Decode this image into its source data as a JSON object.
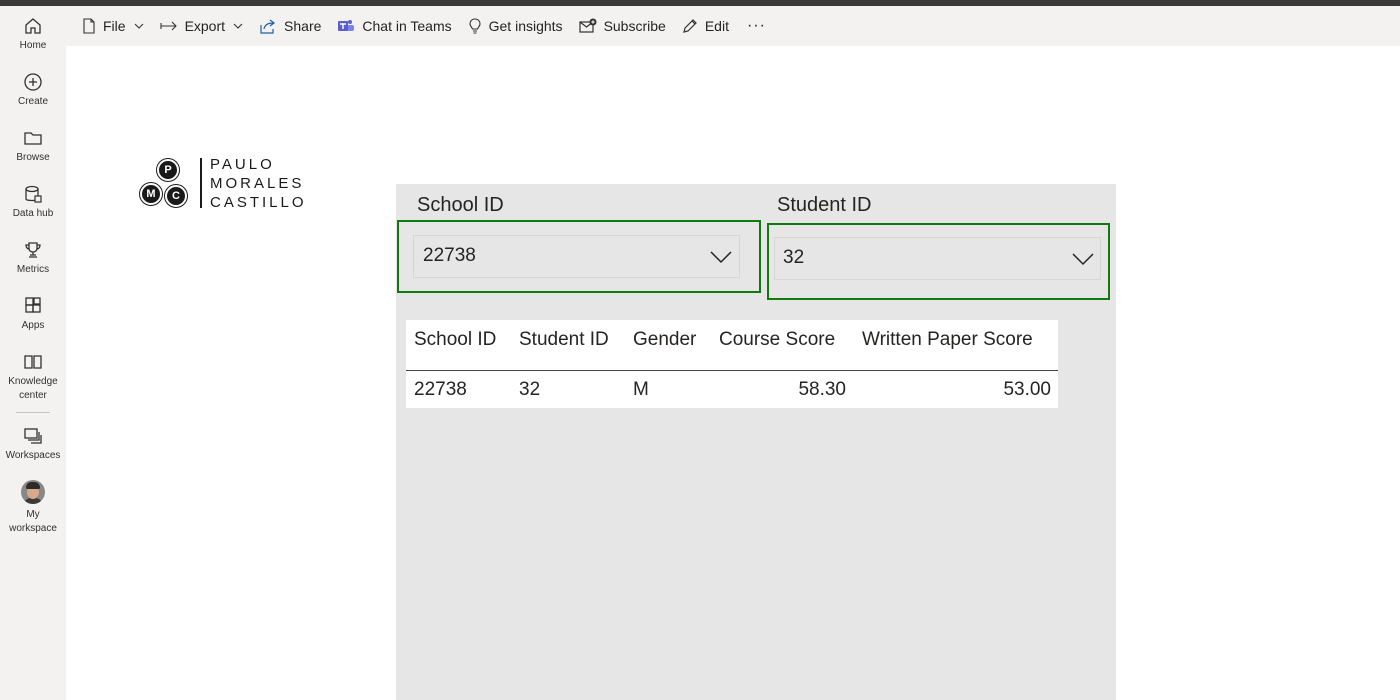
{
  "leftnav": {
    "items": [
      {
        "label": "Home",
        "icon": "home-icon"
      },
      {
        "label": "Create",
        "icon": "plus-circle-icon"
      },
      {
        "label": "Browse",
        "icon": "folder-icon"
      },
      {
        "label": "Data hub",
        "icon": "database-icon"
      },
      {
        "label": "Metrics",
        "icon": "trophy-icon"
      },
      {
        "label": "Apps",
        "icon": "apps-icon"
      },
      {
        "label": "Knowledge",
        "label2": "center",
        "icon": "book-icon"
      },
      {
        "label": "Workspaces",
        "icon": "workspaces-icon"
      },
      {
        "label": "My",
        "label2": "workspace",
        "icon": "avatar"
      }
    ]
  },
  "toolbar": {
    "file": "File",
    "export": "Export",
    "share": "Share",
    "chat": "Chat in Teams",
    "insights": "Get insights",
    "subscribe": "Subscribe",
    "edit": "Edit",
    "more": "···"
  },
  "logo": {
    "line1": "PAULO",
    "line2": "MORALES",
    "line3": "CASTILLO",
    "initials": [
      "P",
      "M",
      "C"
    ]
  },
  "slicers": {
    "school": {
      "title": "School ID",
      "value": "22738"
    },
    "student": {
      "title": "Student ID",
      "value": "32"
    }
  },
  "table": {
    "headers": [
      "School ID",
      "Student ID",
      "Gender",
      "Course Score",
      "Written Paper Score"
    ],
    "rows": [
      [
        "22738",
        "32",
        "M",
        "58.30",
        "53.00"
      ]
    ]
  },
  "colors": {
    "slicer_border": "#0f7b0f",
    "panel_bg": "#e6e6e6",
    "chrome_bg": "#f3f2f1"
  }
}
